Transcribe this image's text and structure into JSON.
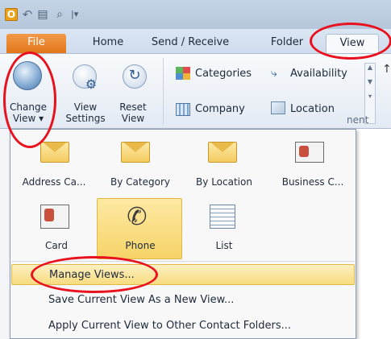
{
  "qat": {
    "app_icon_letter": "O",
    "icons": [
      "outlook-icon",
      "undo-icon",
      "print-icon",
      "print-preview-icon",
      "qat-dropdown-icon"
    ]
  },
  "tabs": {
    "file": "File",
    "home": "Home",
    "send_receive": "Send / Receive",
    "folder": "Folder",
    "view": "View"
  },
  "ribbon": {
    "change_view_line1": "Change",
    "change_view_line2": "View ▾",
    "view_settings_line1": "View",
    "view_settings_line2": "Settings",
    "reset_view_line1": "Reset",
    "reset_view_line2": "View",
    "categories": "Categories",
    "availability": "Availability",
    "company": "Company",
    "location": "Location",
    "group_label_partial": "nent"
  },
  "change_view_menu": {
    "gallery": [
      {
        "label": "Address Ca...",
        "icon": "envelope-icon"
      },
      {
        "label": "By Category",
        "icon": "envelope-icon"
      },
      {
        "label": "By Location",
        "icon": "envelope-icon"
      },
      {
        "label": "Business C...",
        "icon": "business-card-icon"
      },
      {
        "label": "Card",
        "icon": "card-icon"
      },
      {
        "label": "Phone",
        "icon": "phone-icon",
        "selected": true
      },
      {
        "label": "List",
        "icon": "list-icon"
      }
    ],
    "items": {
      "manage": "Manage Views...",
      "save": "Save Current View As a New View...",
      "apply": "Apply Current View to Other Contact Folders..."
    }
  },
  "colors": {
    "annotation_red": "#e8111d",
    "file_tab": "#e27619",
    "selection_yellow": "#f7d469"
  }
}
